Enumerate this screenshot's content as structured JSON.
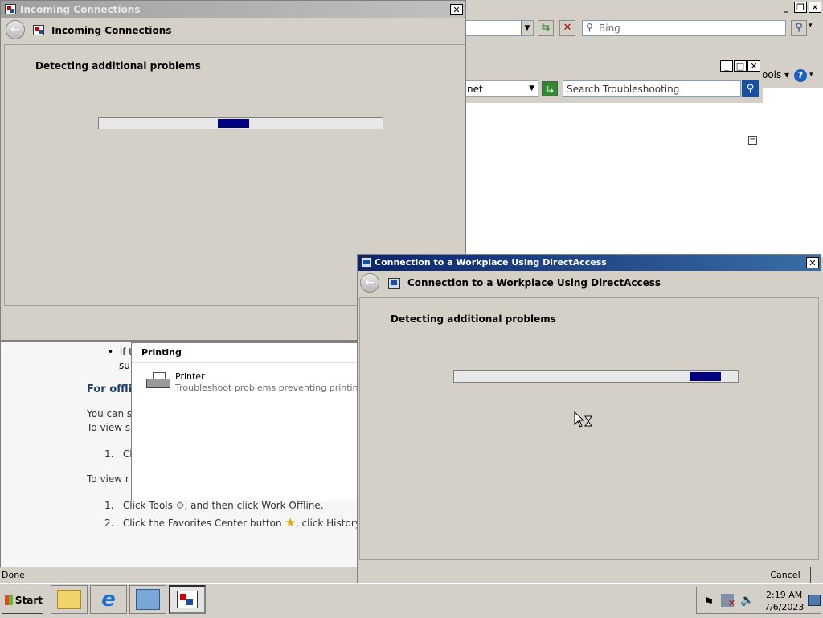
{
  "ie": {
    "search_placeholder": "Bing",
    "tools_label": "ools",
    "help_label": "?"
  },
  "troubleshoot": {
    "location_text": "net",
    "search_placeholder": "Search Troubleshooting"
  },
  "help_pane": {
    "bullet_text_1": "If t",
    "bullet_text_2": "su",
    "offline_heading": "For offli",
    "para1": "You can s",
    "para2": "To view s",
    "step_a": "Cli",
    "para3": "To view r",
    "step1": "Click Tools",
    "step1_rest": ", and then click Work Offline.",
    "step2": "Click the Favorites Center button",
    "step2_rest": ", click History, a",
    "status": "Done"
  },
  "printing_popup": {
    "title": "Printing",
    "item_name": "Printer",
    "item_desc": "Troubleshoot problems preventing printing from"
  },
  "incoming_window": {
    "title": "Incoming Connections",
    "header": "Incoming Connections",
    "status": "Detecting additional problems",
    "progress": 0.11
  },
  "directaccess_window": {
    "title": "Connection to a Workplace Using DirectAccess",
    "header": "Connection to a Workplace Using DirectAccess",
    "status": "Detecting additional problems",
    "progress": 0.11,
    "cancel_label": "Cancel"
  },
  "taskbar": {
    "start_label": "Start",
    "time": "2:19 AM",
    "date": "7/6/2023"
  },
  "colors": {
    "title_active": "#0a246a",
    "progress_fill": "#000080"
  }
}
